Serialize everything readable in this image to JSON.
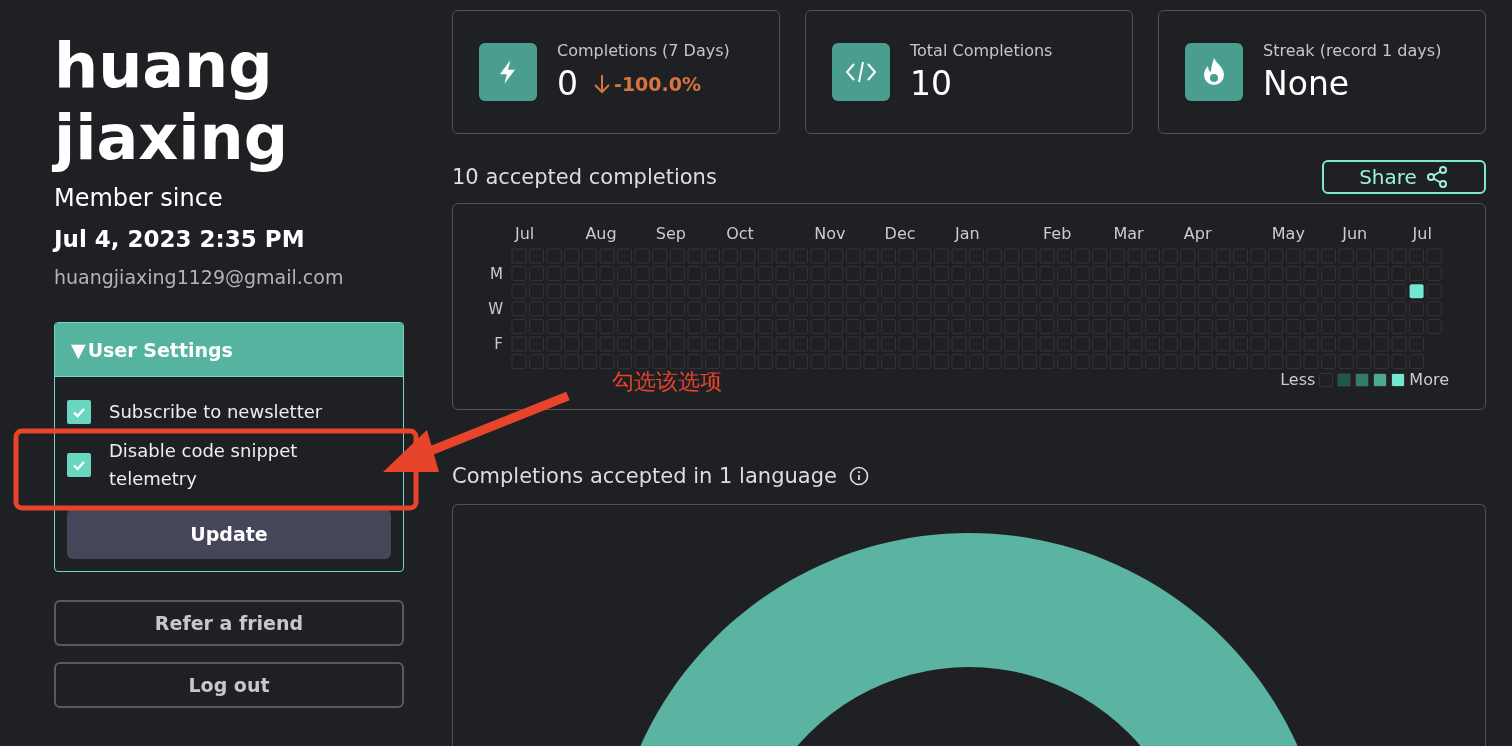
{
  "profile": {
    "name": "huang jiaxing",
    "member_since_label": "Member since",
    "member_since": "Jul 4, 2023 2:35 PM",
    "email": "huangjiaxing1129@gmail.com"
  },
  "settings": {
    "title": "User Settings",
    "expanded": true,
    "toggle": "▼",
    "options": [
      {
        "label": "Subscribe to newsletter",
        "checked": true
      },
      {
        "label": "Disable code snippet telemetry",
        "checked": true
      }
    ],
    "submit": "Update"
  },
  "buttons": [
    "Refer a friend",
    "Log out"
  ],
  "stats": [
    {
      "kind": "bolt",
      "label": "Completions (7 Days)",
      "value": "0",
      "change": "-100.0%"
    },
    {
      "kind": "code",
      "label": "Total Completions",
      "value": "10"
    },
    {
      "kind": "flame",
      "label": "Streak (record 1 days)",
      "value": "None"
    }
  ],
  "activity": {
    "title": "10 accepted completions",
    "share": "Share",
    "months": [
      "Jul",
      "Aug",
      "Sep",
      "Oct",
      "Nov",
      "Dec",
      "Jan",
      "Feb",
      "Mar",
      "Apr",
      "May",
      "Jun",
      "Jul"
    ],
    "weekdays": [
      "M",
      "W",
      "F"
    ],
    "legend": {
      "less": "Less",
      "more": "More"
    }
  },
  "languages": {
    "title": "Completions accepted in 1 language"
  },
  "annotation": {
    "text": "勾选该选项"
  }
}
